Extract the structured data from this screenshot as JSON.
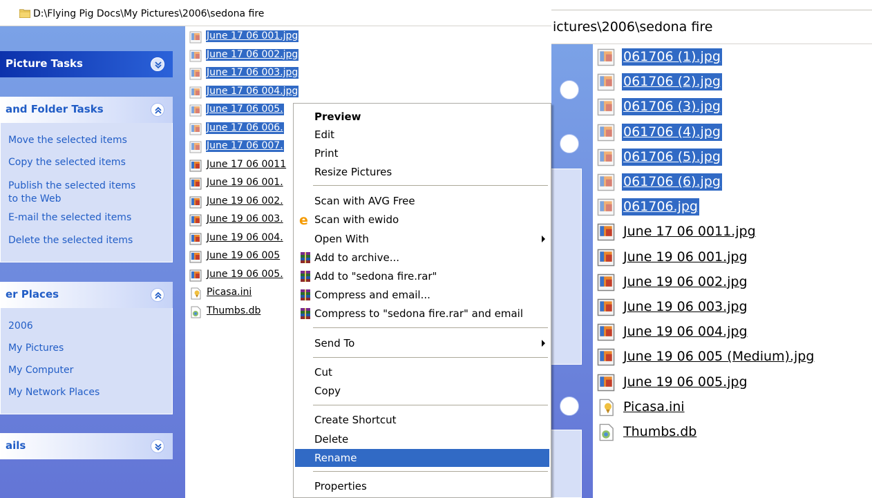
{
  "left_window": {
    "address": "D:\\Flying Pig Docs\\My Pictures\\2006\\sedona fire",
    "taskpane": {
      "picture_tasks": {
        "title": "Picture Tasks"
      },
      "file_folder_tasks": {
        "title": "and Folder Tasks",
        "links": [
          "Move the selected items",
          "Copy the selected items",
          "Publish the selected items",
          "to the Web",
          "E-mail the selected items",
          "Delete the selected items"
        ]
      },
      "other_places": {
        "title": "er Places",
        "links": [
          "2006",
          "My Pictures",
          "My Computer",
          "My Network Places"
        ]
      },
      "details": {
        "title": "ails"
      }
    },
    "files": [
      {
        "name": "June 17 06 001.jpg",
        "selected": true,
        "icon": "jpg-image-icon"
      },
      {
        "name": "June 17 06 002.jpg",
        "selected": true,
        "icon": "jpg-image-icon"
      },
      {
        "name": "June 17 06 003.jpg",
        "selected": true,
        "icon": "jpg-image-icon"
      },
      {
        "name": "June 17 06 004.jpg",
        "selected": true,
        "icon": "jpg-image-icon"
      },
      {
        "name": "June 17 06 005.",
        "selected": true,
        "icon": "jpg-image-icon"
      },
      {
        "name": "June 17 06 006.",
        "selected": true,
        "icon": "jpg-image-icon"
      },
      {
        "name": "June 17 06 007.",
        "selected": true,
        "icon": "jpg-image-icon"
      },
      {
        "name": "June 17 06 0011",
        "selected": false,
        "icon": "jpg-image-icon"
      },
      {
        "name": "June 19 06 001.",
        "selected": false,
        "icon": "jpg-image-icon"
      },
      {
        "name": "June 19 06 002.",
        "selected": false,
        "icon": "jpg-image-icon"
      },
      {
        "name": "June 19 06 003.",
        "selected": false,
        "icon": "jpg-image-icon"
      },
      {
        "name": "June 19 06 004.",
        "selected": false,
        "icon": "jpg-image-icon"
      },
      {
        "name": "June 19 06 005",
        "selected": false,
        "icon": "jpg-image-icon"
      },
      {
        "name": "June 19 06 005.",
        "selected": false,
        "icon": "jpg-image-icon"
      },
      {
        "name": "Picasa.ini",
        "selected": false,
        "icon": "ini-file-icon"
      },
      {
        "name": "Thumbs.db",
        "selected": false,
        "icon": "db-file-icon"
      }
    ]
  },
  "context_menu": {
    "items": {
      "preview": "Preview",
      "edit": "Edit",
      "print": "Print",
      "resize": "Resize Pictures",
      "scan_avg": "Scan with AVG Free",
      "scan_ewido": "Scan with ewido",
      "open_with": "Open With",
      "add_archive": "Add to archive...",
      "add_rar": "Add to \"sedona fire.rar\"",
      "compress_email": "Compress and email...",
      "compress_rar_email": "Compress to \"sedona fire.rar\" and email",
      "send_to": "Send To",
      "cut": "Cut",
      "copy": "Copy",
      "create_shortcut": "Create Shortcut",
      "delete": "Delete",
      "rename": "Rename",
      "properties": "Properties"
    },
    "highlighted": "Rename"
  },
  "right_window": {
    "address": "ictures\\2006\\sedona fire",
    "files": [
      {
        "name": "061706 (1).jpg",
        "selected": true,
        "icon": "jpg-image-icon"
      },
      {
        "name": "061706 (2).jpg",
        "selected": true,
        "icon": "jpg-image-icon"
      },
      {
        "name": "061706 (3).jpg",
        "selected": true,
        "icon": "jpg-image-icon"
      },
      {
        "name": "061706 (4).jpg",
        "selected": true,
        "icon": "jpg-image-icon"
      },
      {
        "name": "061706 (5).jpg",
        "selected": true,
        "icon": "jpg-image-icon"
      },
      {
        "name": "061706 (6).jpg",
        "selected": true,
        "icon": "jpg-image-icon"
      },
      {
        "name": "061706.jpg",
        "selected": true,
        "icon": "jpg-image-icon"
      },
      {
        "name": "June 17 06 0011.jpg",
        "selected": false,
        "icon": "jpg-image-icon"
      },
      {
        "name": "June 19 06 001.jpg",
        "selected": false,
        "icon": "jpg-image-icon"
      },
      {
        "name": "June 19 06 002.jpg",
        "selected": false,
        "icon": "jpg-image-icon"
      },
      {
        "name": "June 19 06 003.jpg",
        "selected": false,
        "icon": "jpg-image-icon"
      },
      {
        "name": "June 19 06 004.jpg",
        "selected": false,
        "icon": "jpg-image-icon"
      },
      {
        "name": "June 19 06 005 (Medium).jpg",
        "selected": false,
        "icon": "jpg-image-icon"
      },
      {
        "name": "June 19 06 005.jpg",
        "selected": false,
        "icon": "jpg-image-icon"
      },
      {
        "name": "Picasa.ini",
        "selected": false,
        "icon": "ini-file-icon"
      },
      {
        "name": "Thumbs.db",
        "selected": false,
        "icon": "db-file-icon"
      }
    ]
  },
  "colors": {
    "selection": "#316ac5",
    "taskpane_gradient_top": "#7ba2e7",
    "taskpane_gradient_bottom": "#6375d6",
    "taskpane_box": "#d6dff7",
    "link": "#215dc6"
  }
}
